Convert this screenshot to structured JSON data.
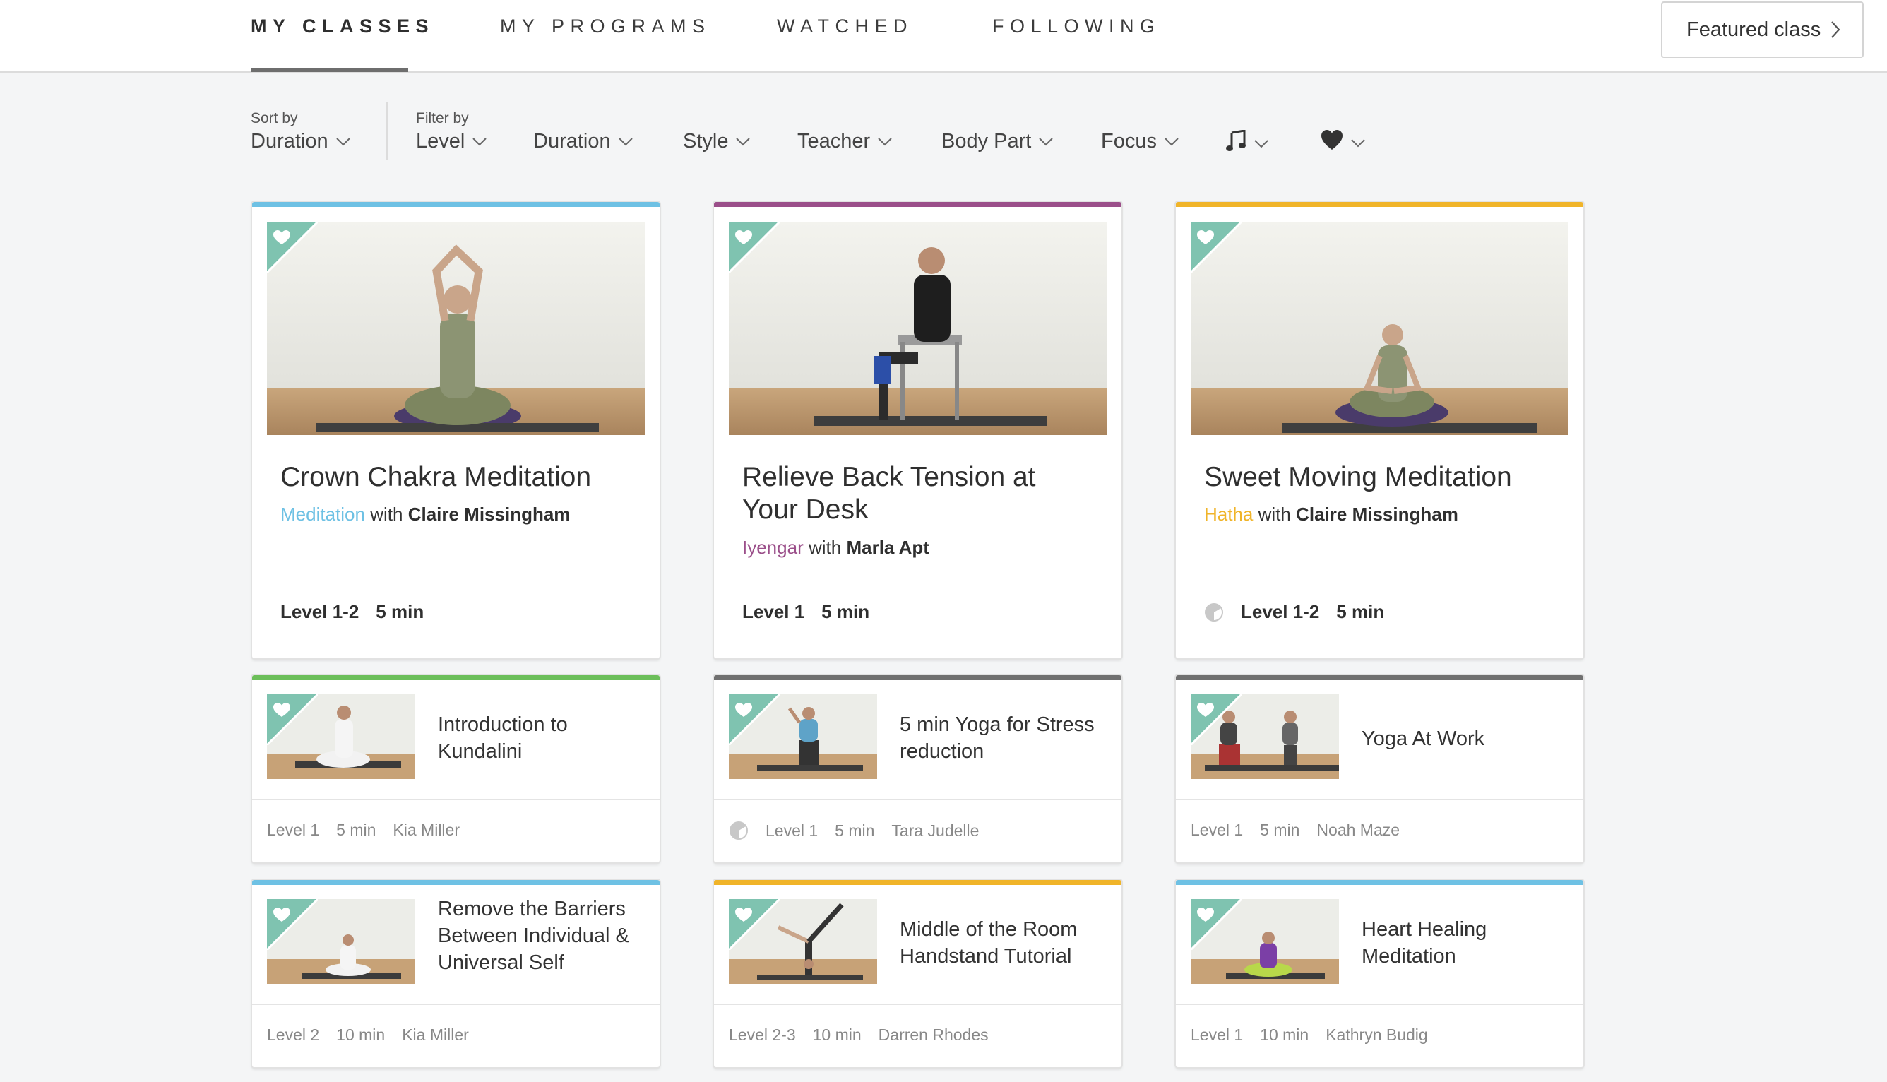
{
  "tabs": [
    {
      "label": "MY CLASSES",
      "active": true
    },
    {
      "label": "MY PROGRAMS",
      "active": false
    },
    {
      "label": "WATCHED",
      "active": false
    },
    {
      "label": "FOLLOWING",
      "active": false
    }
  ],
  "featured_button": {
    "label": "Featured class",
    "icon": "chevron-right-icon"
  },
  "sort": {
    "label": "Sort by",
    "value": "Duration"
  },
  "filter": {
    "label": "Filter by",
    "options": [
      {
        "value": "Level"
      },
      {
        "value": "Duration"
      },
      {
        "value": "Style"
      },
      {
        "value": "Teacher"
      },
      {
        "value": "Body Part"
      },
      {
        "value": "Focus"
      },
      {
        "value": "",
        "icon": "music-note-icon"
      },
      {
        "value": "",
        "icon": "heart-icon"
      }
    ]
  },
  "colors": {
    "meditation": "#6ec1e4",
    "iyengar": "#9b4f8a",
    "hatha": "#f0b429",
    "kundalini": "#6cbf5a",
    "gray": "#707070",
    "fav_badge": "#7fc3b0"
  },
  "featured_cards": [
    {
      "title": "Crown Chakra Meditation",
      "style": "Meditation",
      "with": "with",
      "teacher": "Claire Missingham",
      "level": "Level 1-2",
      "duration": "5 min",
      "accent": "#6ec1e4",
      "style_color": "#6ec1e4",
      "partial": false
    },
    {
      "title": "Relieve Back Tension at Your Desk",
      "style": "Iyengar",
      "with": "with",
      "teacher": "Marla Apt",
      "level": "Level 1",
      "duration": "5 min",
      "accent": "#9b4f8a",
      "style_color": "#9b4f8a",
      "partial": false
    },
    {
      "title": "Sweet Moving Meditation",
      "style": "Hatha",
      "with": "with",
      "teacher": "Claire Missingham",
      "level": "Level 1-2",
      "duration": "5 min",
      "accent": "#f0b429",
      "style_color": "#f0b429",
      "partial": true
    }
  ],
  "small_cards": [
    {
      "title": "Introduction to Kundalini",
      "level": "Level 1",
      "duration": "5 min",
      "teacher": "Kia Miller",
      "accent": "#6cbf5a",
      "partial": false
    },
    {
      "title": "5 min Yoga for Stress reduction",
      "level": "Level 1",
      "duration": "5 min",
      "teacher": "Tara Judelle",
      "accent": "#707070",
      "partial": true
    },
    {
      "title": "Yoga At Work",
      "level": "Level 1",
      "duration": "5 min",
      "teacher": "Noah Maze",
      "accent": "#707070",
      "partial": false
    },
    {
      "title": "Remove the Barriers Between Individual & Universal Self",
      "level": "Level 2",
      "duration": "10 min",
      "teacher": "Kia Miller",
      "accent": "#6ec1e4",
      "partial": false
    },
    {
      "title": "Middle of the Room Handstand Tutorial",
      "level": "Level 2-3",
      "duration": "10 min",
      "teacher": "Darren Rhodes",
      "accent": "#f0b429",
      "partial": false
    },
    {
      "title": "Heart Healing Meditation",
      "level": "Level 1",
      "duration": "10 min",
      "teacher": "Kathryn Budig",
      "accent": "#6ec1e4",
      "partial": false
    }
  ]
}
